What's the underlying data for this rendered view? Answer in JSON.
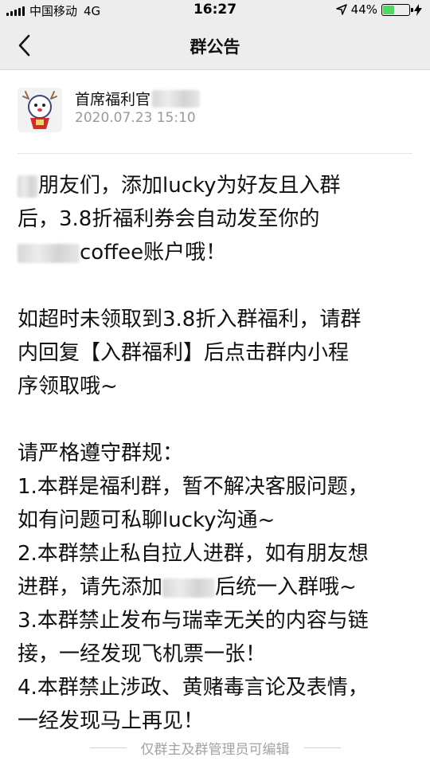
{
  "status_bar": {
    "carrier": "中国移动",
    "network": "4G",
    "time": "16:27",
    "battery_percent": "44%",
    "battery_level": 0.44,
    "battery_color": "#4cd964"
  },
  "nav": {
    "title": "群公告",
    "back_icon": "chevron-left-icon"
  },
  "author": {
    "name": "首席福利官",
    "date": "2020.07.23 15:10"
  },
  "content": {
    "p1": [
      "朋友们，添加lucky为好友且入群",
      "后，3.8折福利券会自动发至你的",
      "coffee账户哦！"
    ],
    "p2": [
      "如超时未领取到3.8折入群福利，请群",
      "内回复【入群福利】后点击群内小程",
      "序领取哦~"
    ],
    "rules_title": "请严格遵守群规：",
    "rule1": [
      "1.本群是福利群，暂不解决客服问题，",
      "如有问题可私聊lucky沟通~"
    ],
    "rule2": [
      "2.本群禁止私自拉人进群，如有朋友想",
      "进群，请先添加",
      "后统一入群哦~"
    ],
    "rule3": [
      "3.本群禁止发布与瑞幸无关的内容与链",
      "接，一经发现飞机票一张！"
    ],
    "rule4": [
      "4.本群禁止涉政、黄赌毒言论及表情，",
      "一经发现马上再见！"
    ]
  },
  "footer": {
    "text": "仅群主及群管理员可编辑"
  }
}
